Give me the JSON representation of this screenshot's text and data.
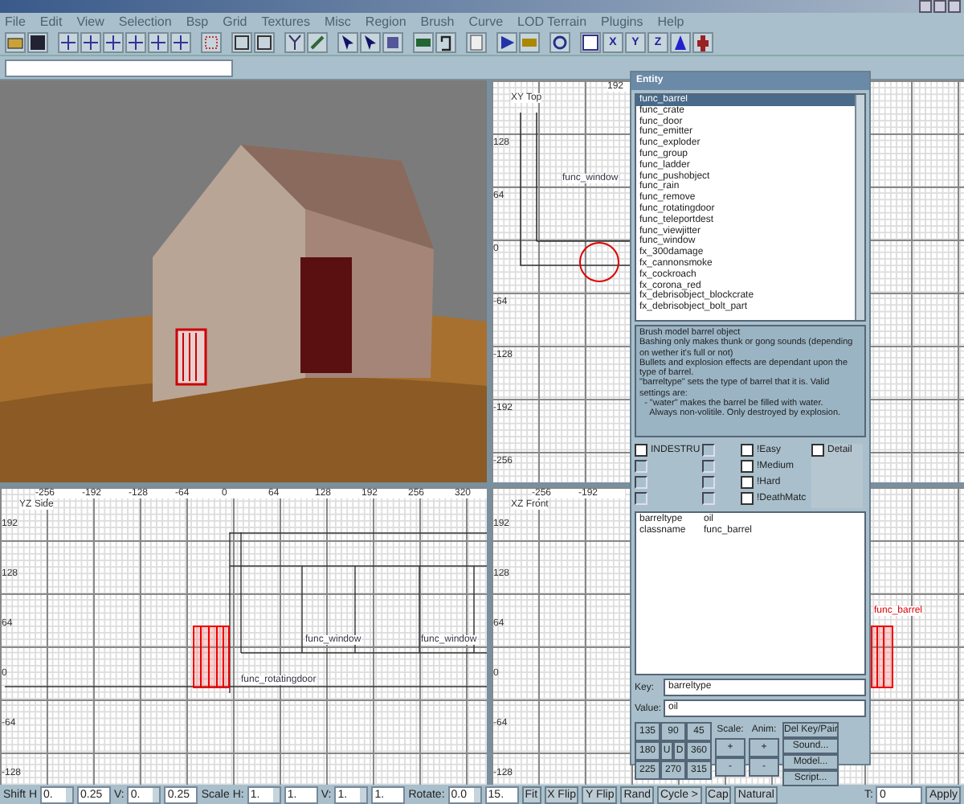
{
  "menu": [
    "File",
    "Edit",
    "View",
    "Selection",
    "Bsp",
    "Grid",
    "Textures",
    "Misc",
    "Region",
    "Brush",
    "Curve",
    "LOD Terrain",
    "Plugins",
    "Help"
  ],
  "toolbar_axis_buttons": [
    "X",
    "Y",
    "Z"
  ],
  "views": [
    {
      "kind": "camera"
    },
    {
      "kind": "ortho",
      "title": "XY Top",
      "x_ticks": [
        "192"
      ],
      "y_ticks": [
        "128",
        "64",
        "0",
        "-64",
        "-128",
        "-192",
        "-256"
      ],
      "labels": [
        "func_window"
      ]
    },
    {
      "kind": "ortho",
      "title": "YZ Side",
      "x_ticks": [
        "-256",
        "-192",
        "-128",
        "-64",
        "0",
        "64",
        "128",
        "192",
        "256",
        "320"
      ],
      "y_ticks": [
        "192",
        "128",
        "64",
        "0",
        "-64",
        "-128"
      ],
      "labels": [
        "func_window",
        "func_window",
        "func_rotatingdoor"
      ]
    },
    {
      "kind": "ortho",
      "title": "XZ Front",
      "x_ticks": [
        "-256",
        "-192"
      ],
      "y_ticks": [
        "192",
        "128",
        "64",
        "0",
        "-64",
        "-128"
      ],
      "labels": [
        "func_barrel"
      ]
    }
  ],
  "entity": {
    "title": "Entity",
    "classes": [
      {
        "name": "func_barrel",
        "selected": true
      },
      {
        "name": "func_crate",
        "selected": false
      },
      {
        "name": "func_door",
        "selected": false
      },
      {
        "name": "func_emitter",
        "selected": false
      },
      {
        "name": "func_exploder",
        "selected": false
      },
      {
        "name": "func_group",
        "selected": false
      },
      {
        "name": "func_ladder",
        "selected": false
      },
      {
        "name": "func_pushobject",
        "selected": false
      },
      {
        "name": "func_rain",
        "selected": false
      },
      {
        "name": "func_remove",
        "selected": false
      },
      {
        "name": "func_rotatingdoor",
        "selected": false
      },
      {
        "name": "func_teleportdest",
        "selected": false
      },
      {
        "name": "func_viewjitter",
        "selected": false
      },
      {
        "name": "func_window",
        "selected": false
      },
      {
        "name": "fx_300damage",
        "selected": false
      },
      {
        "name": "fx_cannonsmoke",
        "selected": false
      },
      {
        "name": "fx_cockroach",
        "selected": false
      },
      {
        "name": "fx_corona_red",
        "selected": false
      },
      {
        "name": "fx_debrisobject_blockcrate",
        "selected": false
      },
      {
        "name": "fx_debrisobject_bolt_part",
        "selected": false
      }
    ],
    "description": [
      "Brush model barrel object",
      "Bashing only makes thunk or gong sounds (depending on wether it's full or not)",
      "Bullets and explosion effects are dependant upon the type of barrel.",
      "\"barreltype\" sets the type of barrel that it is. Valid settings are:",
      "  - \"water\" makes the barrel be filled with water.",
      "    Always non-volitile. Only destroyed by explosion."
    ],
    "flag_columns": [
      [
        {
          "label": "INDESTRU",
          "checked": false,
          "disabled": false
        },
        {
          "checked": false,
          "disabled": true
        },
        {
          "checked": false,
          "disabled": true
        },
        {
          "checked": false,
          "disabled": true
        }
      ],
      [
        {
          "checked": false,
          "disabled": true
        },
        {
          "checked": false,
          "disabled": true
        },
        {
          "checked": false,
          "disabled": true
        },
        {
          "checked": false,
          "disabled": true
        }
      ],
      [
        {
          "label": "!Easy",
          "checked": false,
          "disabled": false
        },
        {
          "label": "!Medium",
          "checked": false,
          "disabled": false
        },
        {
          "label": "!Hard",
          "checked": false,
          "disabled": false
        },
        {
          "label": "!DeathMatc",
          "checked": false,
          "disabled": false
        }
      ],
      [
        {
          "label": "Detail",
          "checked": false,
          "disabled": false
        }
      ]
    ],
    "pairs": [
      {
        "key": "barreltype",
        "value": "oil"
      },
      {
        "key": "classname",
        "value": "func_barrel"
      }
    ],
    "key_label": "Key:",
    "key_value": "barreltype",
    "value_label": "Value:",
    "value_value": "oil",
    "angles": [
      [
        "135",
        "90",
        "45"
      ],
      [
        "180",
        "U",
        "D",
        "360"
      ],
      [
        "225",
        "270",
        "315"
      ]
    ],
    "scale": {
      "label": "Scale:",
      "buttons": [
        "+",
        "-"
      ]
    },
    "anim": {
      "label": "Anim:",
      "buttons": [
        "+",
        "-"
      ]
    },
    "actions": [
      "Del Key/Pair",
      "Sound...",
      "Model...",
      "Script..."
    ]
  },
  "bottom_left": [
    {
      "kind": "label",
      "text": "Shift H"
    },
    {
      "kind": "spin",
      "text": "0."
    },
    {
      "kind": "field",
      "text": "0.25"
    },
    {
      "kind": "label",
      "text": "V:"
    },
    {
      "kind": "spin",
      "text": "0."
    },
    {
      "kind": "field",
      "text": "0.25"
    },
    {
      "kind": "label",
      "text": "Scale H:"
    },
    {
      "kind": "spin",
      "text": "1."
    },
    {
      "kind": "field",
      "text": "1."
    },
    {
      "kind": "label",
      "text": "V:"
    },
    {
      "kind": "spin",
      "text": "1."
    },
    {
      "kind": "field",
      "text": "1."
    },
    {
      "kind": "label",
      "text": "Rotate:"
    },
    {
      "kind": "spin",
      "text": "0.0"
    },
    {
      "kind": "field",
      "text": "15."
    },
    {
      "kind": "button",
      "text": "Fit"
    },
    {
      "kind": "button",
      "text": "X Flip"
    },
    {
      "kind": "button",
      "text": "Y Flip"
    },
    {
      "kind": "button",
      "text": "Rand"
    },
    {
      "kind": "button",
      "text": "Cycle >"
    },
    {
      "kind": "button",
      "text": "Cap"
    },
    {
      "kind": "button",
      "text": "Natural"
    }
  ],
  "bottom_right": [
    {
      "kind": "label",
      "text": "T:"
    },
    {
      "kind": "field",
      "text": "0"
    },
    {
      "kind": "button",
      "text": "Apply"
    }
  ]
}
